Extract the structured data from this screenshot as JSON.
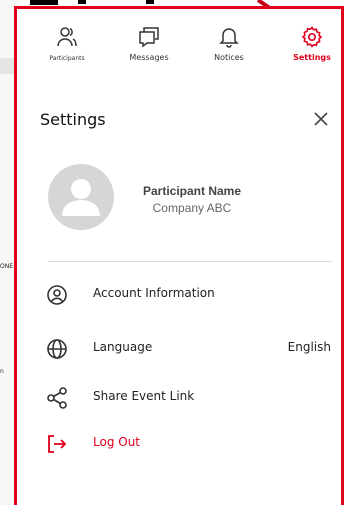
{
  "tabs": [
    {
      "label": "Participants",
      "icon": "participants-icon"
    },
    {
      "label": "Messages",
      "icon": "messages-icon"
    },
    {
      "label": "Notices",
      "icon": "bell-icon"
    },
    {
      "label": "Settings",
      "icon": "gear-icon"
    }
  ],
  "settings": {
    "title": "Settings",
    "close_icon": "close-icon"
  },
  "profile": {
    "name": "Participant Name",
    "company": "Company ABC"
  },
  "menu": {
    "account": {
      "label": "Account Information",
      "icon": "user-circle-icon"
    },
    "language": {
      "label": "Language",
      "value": "English",
      "icon": "globe-icon"
    },
    "share": {
      "label": "Share Event Link",
      "icon": "share-icon"
    },
    "logout": {
      "label": "Log Out",
      "icon": "logout-icon"
    }
  },
  "colors": {
    "accent": "#e0001b",
    "text": "#222222",
    "muted": "#666666",
    "avatar_bg": "#d6d6d6"
  }
}
